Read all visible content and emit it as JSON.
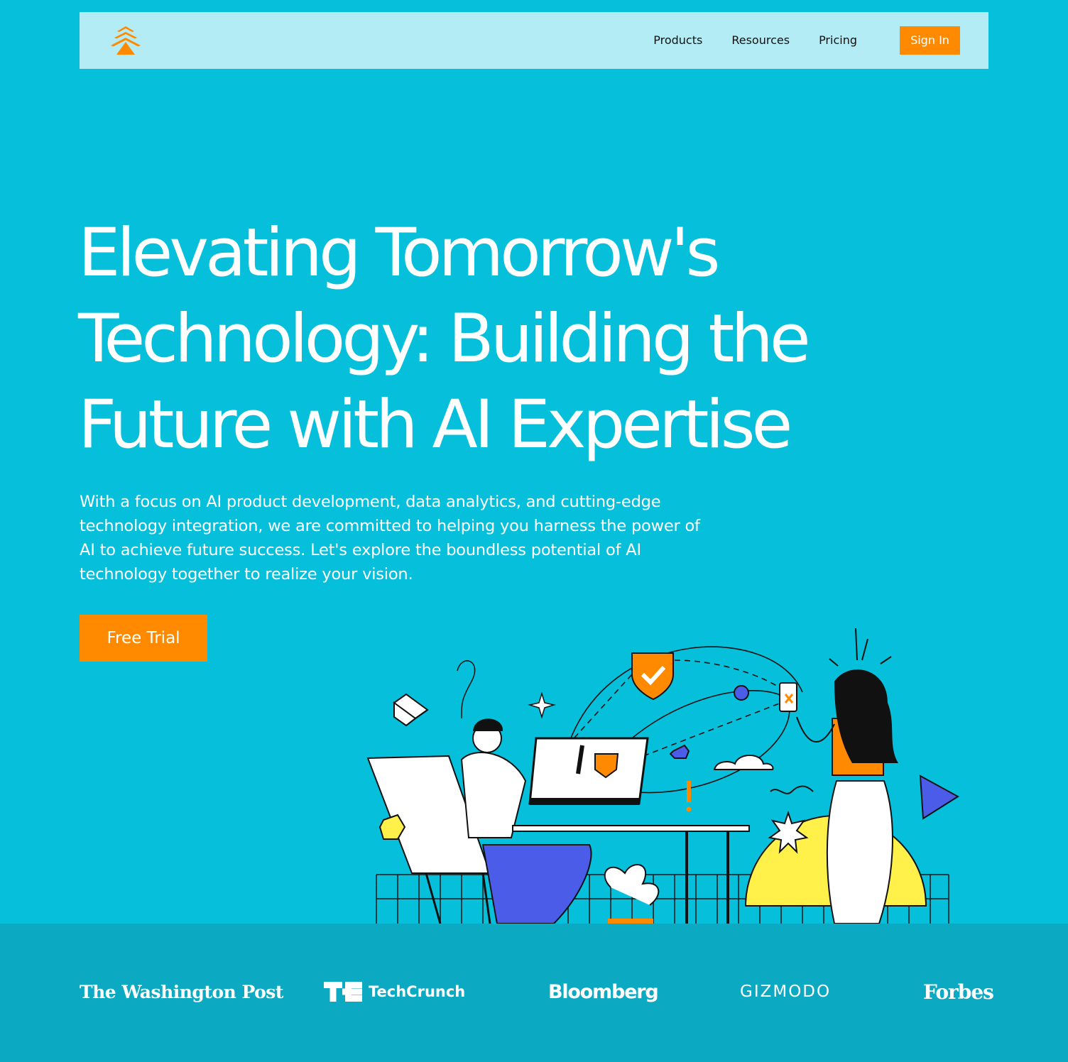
{
  "nav": {
    "logo_icon": "pine-tree-logo-icon",
    "links": [
      "Products",
      "Resources",
      "Pricing"
    ],
    "signin_label": "Sign In"
  },
  "hero": {
    "title": "Elevating Tomorrow's Technology: Building the Future with AI Expertise",
    "description": "With a focus on AI product development, data analytics, and cutting-edge technology integration, we are committed to helping you harness the power of AI to achieve future success. Let's explore the boundless potential of AI technology together to realize your vision.",
    "cta_label": "Free Trial"
  },
  "press": {
    "logos": [
      "The Washington Post",
      "TechCrunch",
      "Bloomberg",
      "GIZMODO",
      "Forbes"
    ]
  },
  "colors": {
    "background": "#05BFDB",
    "navbar": "#B3ECF4",
    "accent": "#FF8A00",
    "press_band": "#0CA9C2"
  }
}
